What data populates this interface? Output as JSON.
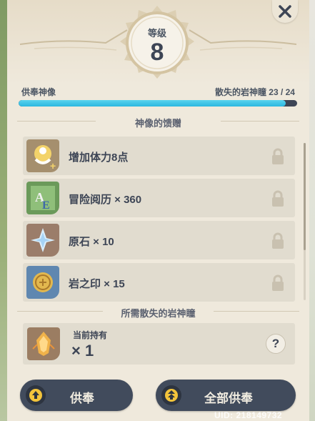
{
  "header": {
    "level_label": "等级",
    "level_value": "8",
    "close_icon": "close-icon"
  },
  "progress": {
    "left_label": "供奉神像",
    "right_label": "散失的岩神瞳 23 / 24",
    "current": 23,
    "total": 24
  },
  "rewards_section": {
    "title": "神像的馈赠",
    "items": [
      {
        "label": "增加体力8点",
        "icon": "stamina-icon",
        "locked": true
      },
      {
        "label": "冒险阅历 × 360",
        "icon": "adventure-exp-icon",
        "locked": true
      },
      {
        "label": "原石 × 10",
        "icon": "primogem-icon",
        "locked": true
      },
      {
        "label": "岩之印 × 15",
        "icon": "mora-seal-icon",
        "locked": true
      }
    ]
  },
  "required_section": {
    "title": "所需散失的岩神瞳",
    "hold_label": "当前持有",
    "hold_count": "× 1",
    "help_label": "?"
  },
  "buttons": {
    "offer_label": "供奉",
    "offer_all_label": "全部供奉"
  },
  "footer": {
    "uid": "UID: 218149732"
  },
  "colors": {
    "panel": "#efe9dc",
    "row": "#e1dccf",
    "text": "#3d4555",
    "progress": "#2bb7df",
    "button": "#414b5c"
  }
}
